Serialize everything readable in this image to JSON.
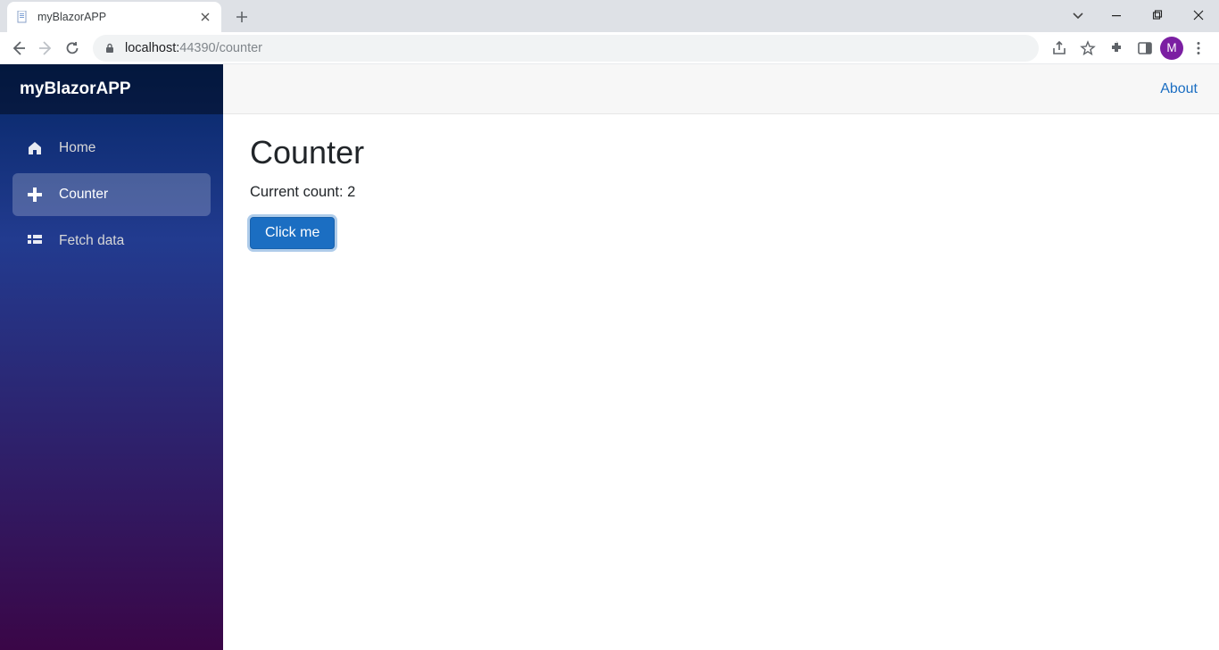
{
  "browser": {
    "tab_title": "myBlazorAPP",
    "url_host": "localhost:",
    "url_port": "44390",
    "url_path": "/counter",
    "avatar_letter": "M"
  },
  "sidebar": {
    "brand": "myBlazorAPP",
    "items": [
      {
        "label": "Home"
      },
      {
        "label": "Counter"
      },
      {
        "label": "Fetch data"
      }
    ]
  },
  "top_row": {
    "about_label": "About"
  },
  "page": {
    "heading": "Counter",
    "count_prefix": "Current count: ",
    "count_value": "2",
    "button_label": "Click me"
  }
}
